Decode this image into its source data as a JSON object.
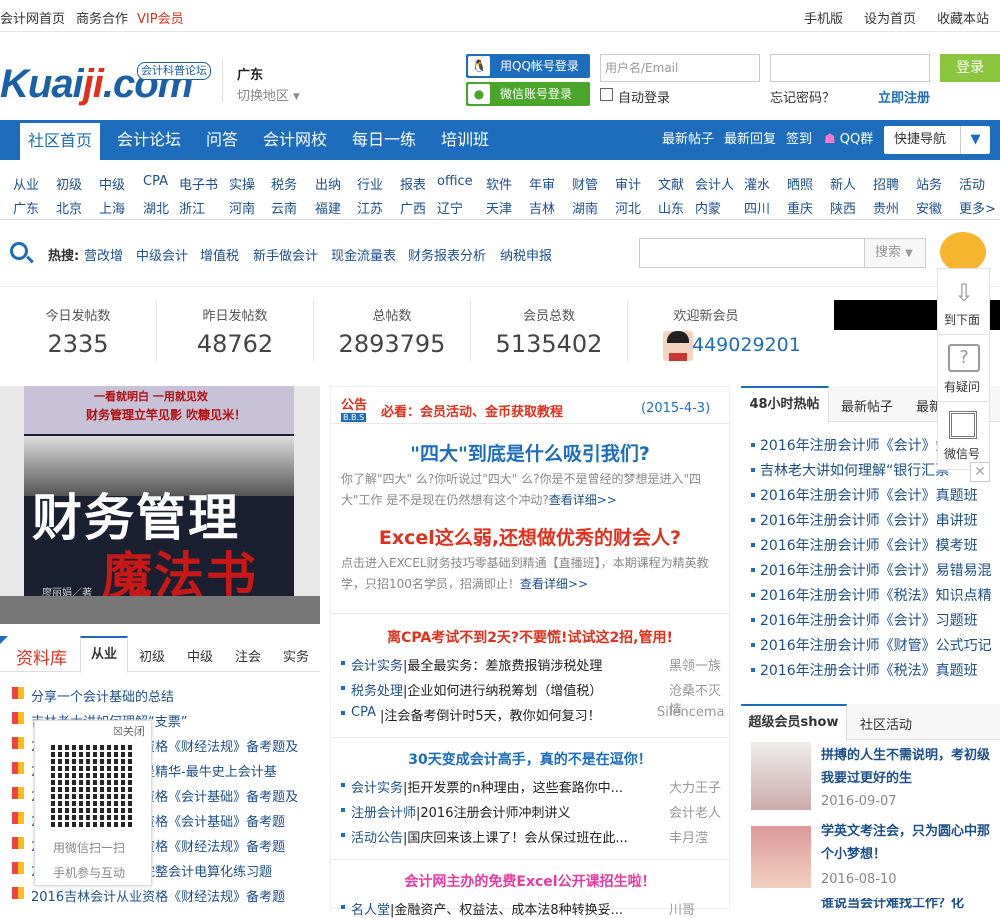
{
  "topbar": {
    "home": "会计网首页",
    "biz": "商务合作",
    "vip": "VIP会员",
    "mobile": "手机版",
    "sethome": "设为首页",
    "fav": "收藏本站"
  },
  "header": {
    "logo_main": "Kuai",
    "logo_accent": "ji",
    "logo_tld": ".com",
    "logo_tag": "会计科普论坛",
    "region": "广东",
    "switch_region": "切换地区"
  },
  "login": {
    "qq": "用QQ帐号登录",
    "wechat": "微信账号登录",
    "username_placeholder": "用户名/Email",
    "auto_login": "自动登录",
    "forgot": "忘记密码？",
    "register": "立即注册",
    "submit": "登录"
  },
  "nav": {
    "items": [
      "社区首页",
      "会计论坛",
      "问答",
      "会计网校",
      "每日一练",
      "培训班"
    ],
    "right": [
      "最新帖子",
      "最新回复",
      "签到",
      "QQ群"
    ],
    "quick": "快捷导航"
  },
  "links": {
    "row1": [
      "从业",
      "初级",
      "中级",
      "CPA",
      "电子书",
      "实操",
      "税务",
      "出纳",
      "行业",
      "报表",
      "office",
      "软件",
      "年审",
      "财管",
      "审计",
      "文献",
      "会计人",
      "灌水",
      "晒照",
      "新人",
      "招聘",
      "站务",
      "活动"
    ],
    "row2": [
      "广东",
      "北京",
      "上海",
      "湖北",
      "浙江",
      "河南",
      "云南",
      "福建",
      "江苏",
      "广西",
      "辽宁",
      "天津",
      "吉林",
      "湖南",
      "河北",
      "山东",
      "内蒙",
      "四川",
      "重庆",
      "陕西",
      "贵州",
      "安徽",
      "更多>"
    ]
  },
  "search": {
    "hot_label": "热搜:",
    "hot": [
      "营改增",
      "中级会计",
      "增值税",
      "新手做会计",
      "现金流量表",
      "财务报表分析",
      "纳税申报"
    ],
    "button": "搜索"
  },
  "stats": [
    {
      "label": "今日发帖数",
      "value": "2335"
    },
    {
      "label": "昨日发帖数",
      "value": "48762"
    },
    {
      "label": "总帖数",
      "value": "2893795"
    },
    {
      "label": "会员总数",
      "value": "5135402"
    },
    {
      "label": "欢迎新会员",
      "value": "449029201"
    }
  ],
  "book": {
    "slogan1": "一看就明白 一用就见效",
    "slogan2": "财务管理立竿见影 吹糠见米！",
    "title1": "财务管理",
    "title2": "魔法书",
    "author": "廖丽娟／著"
  },
  "library": {
    "title": "资料库",
    "tabs": [
      "从业",
      "初级",
      "中级",
      "注会",
      "实务"
    ],
    "items": [
      "分享一个会计基础的总结",
      "吉林老大讲如何理解“支票”",
      "2016吉林会计从业资格《财经法规》备考题及",
      "2016吉林会计从业是精华-最牛史上会计基",
      "2016吉林会计从业资格《会计基础》备考题及",
      "2016吉林会计从业资格《会计基础》备考题",
      "2016吉林会计从业资格《财经法规》备考题",
      "2016吉林会计从业完整会计电算化练习题",
      "2016吉林会计从业资格《财经法规》备考题"
    ]
  },
  "qr_popup": {
    "close": "关闭",
    "line1": "用微信扫一扫",
    "line2": "手机参与互动"
  },
  "notice": {
    "badge": "公告",
    "sub": "B.B.S",
    "title": "必看：会员活动、金币获取教程",
    "date": "(2015-4-3)"
  },
  "features": [
    {
      "title": "\"四大\"到底是什么吸引我们?",
      "desc": "你了解\"四大\" 么?你听说过\"四大\" 么?你是不是曾经的梦想是进入\"四大\"工作 是不是现在仍然想有这个冲动?",
      "more": "查看详细>>"
    },
    {
      "title": "Excel这么弱,还想做优秀的财会人?",
      "desc": "点击进入EXCEL财务技巧零基础到精通【直播班】，本期课程为精英教学，只招100名学员，招满即止！",
      "more": "查看详细>>"
    }
  ],
  "blocks": [
    {
      "head": "离CPA考试不到2天?不要慌!试试这2招,管用!",
      "rows": [
        [
          "会计实务",
          "|最全最实务：差旅费报销涉税处理",
          "黑领一族"
        ],
        [
          "税务处理",
          "|企业如何进行纳税筹划（增值税）",
          "沧桑不灭情"
        ],
        [
          "CPA",
          "|注会备考倒计时5天，教你如何复习！",
          "Silencema"
        ]
      ]
    },
    {
      "head": "30天变成会计高手，真的不是在逗你！",
      "rows": [
        [
          "会计实务",
          "|拒开发票的n种理由，这些套路你中...",
          "大力王子"
        ],
        [
          "注册会计师",
          "|2016注册会计师冲刺讲义",
          "会计老人"
        ],
        [
          "活动公告",
          "|国庆回来该上课了！会从保过班在此...",
          "丰月滢"
        ]
      ]
    },
    {
      "head": "会计网主办的免费Excel公开课招生啦！",
      "rows": [
        [
          "名人堂",
          "|金融资产、权益法、成本法8种转换妥...",
          "川哥"
        ]
      ]
    }
  ],
  "hot": {
    "tabs": [
      "48小时热帖",
      "最新帖子",
      "最新"
    ],
    "items": [
      "2016年注册会计师《会计》知",
      "吉林老大讲如何理解“银行汇票”",
      "2016年注册会计师《会计》真题班",
      "2016年注册会计师《会计》串讲班",
      "2016年注册会计师《会计》模考班",
      "2016年注册会计师《会计》易错易混",
      "2016年注册会计师《税法》知识点精",
      "2016年注册会计师《会计》习题班",
      "2016年注册会计师《财管》公式巧记",
      "2016年注册会计师《税法》真题班"
    ]
  },
  "members": {
    "tabs": [
      "超级会员show",
      "社区活动"
    ],
    "items": [
      {
        "title": "拼搏的人生不需说明，考初级我要过更好的生",
        "date": "2016-09-07"
      },
      {
        "title": "学英文考注会，只为圆心中那个小梦想！",
        "date": "2016-08-10"
      },
      {
        "title": "谁说当会计难找工作？化",
        "date": ""
      }
    ]
  },
  "float": {
    "down": "到下面",
    "ask": "有疑问",
    "wechat": "微信号"
  }
}
